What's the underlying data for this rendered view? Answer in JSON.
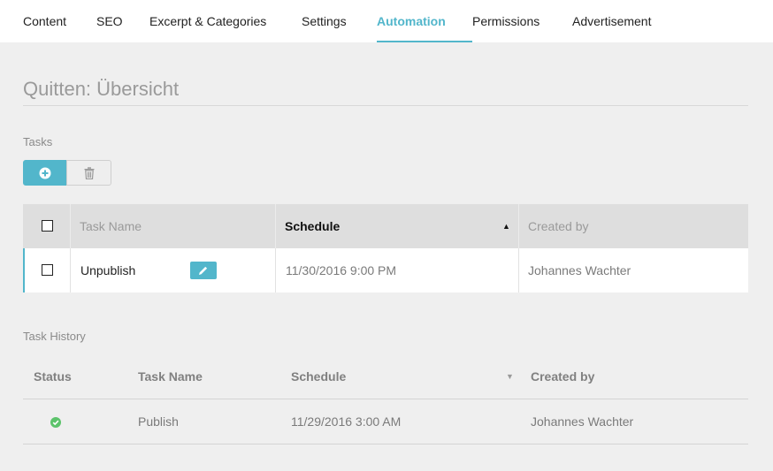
{
  "nav": {
    "tabs": [
      {
        "label": "Content"
      },
      {
        "label": "SEO"
      },
      {
        "label": "Excerpt & Categories"
      },
      {
        "label": "Settings"
      },
      {
        "label": "Automation"
      },
      {
        "label": "Permissions"
      },
      {
        "label": "Advertisement"
      }
    ],
    "active_tab": "Automation"
  },
  "page": {
    "title": "Quitten: Übersicht"
  },
  "tasks": {
    "label": "Tasks",
    "add_icon": "plus-circle-icon",
    "delete_icon": "trash-icon",
    "columns": {
      "task_name": "Task Name",
      "schedule": "Schedule",
      "created_by": "Created by"
    },
    "sort": {
      "column": "Schedule",
      "direction": "ascending"
    },
    "rows": [
      {
        "task_name": "Unpublish",
        "schedule": "11/30/2016 9:00 PM",
        "created_by": "Johannes Wachter",
        "checked": false
      }
    ]
  },
  "history": {
    "label": "Task History",
    "columns": {
      "status": "Status",
      "task_name": "Task Name",
      "schedule": "Schedule",
      "created_by": "Created by"
    },
    "sort": {
      "column": "Schedule",
      "direction": "descending"
    },
    "rows": [
      {
        "status": "success",
        "task_name": "Publish",
        "schedule": "11/29/2016 3:00 AM",
        "created_by": "Johannes Wachter"
      }
    ]
  },
  "colors": {
    "accent": "#52b6cb",
    "success": "#5cc36b"
  }
}
